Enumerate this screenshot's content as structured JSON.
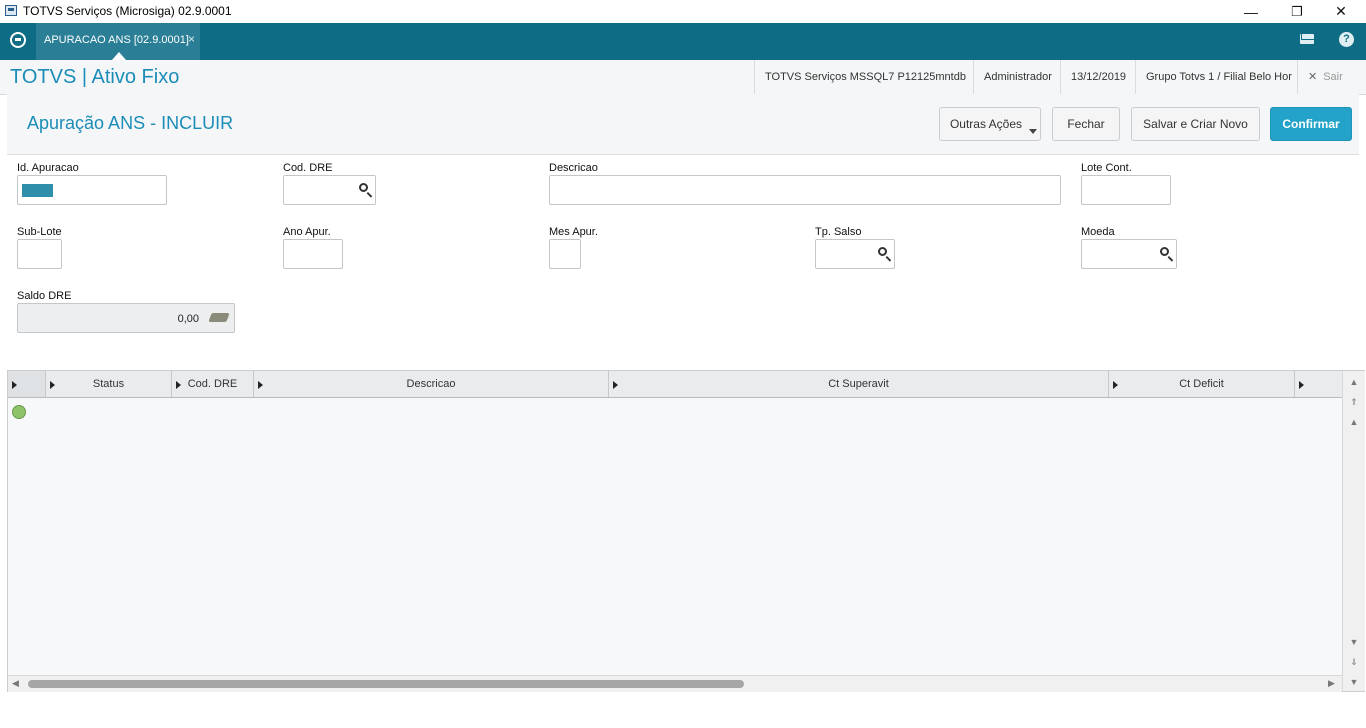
{
  "window": {
    "title": "TOTVS Serviços (Microsiga) 02.9.0001",
    "minimize": "—",
    "restore": "❐",
    "close": "✕"
  },
  "tabbar": {
    "active_tab": "APURACAO ANS [02.9.0001]",
    "tab_close": "×",
    "help": "?"
  },
  "header": {
    "app_title": "TOTVS | Ativo Fixo",
    "environment": "TOTVS Serviços MSSQL7 P12125mntdb",
    "user": "Administrador",
    "date": "13/12/2019",
    "company": "Grupo Totvs 1 / Filial Belo Hor",
    "exit_label": "Sair",
    "exit_icon": "✕"
  },
  "form": {
    "title": "Apuração ANS - INCLUIR",
    "buttons": {
      "more_actions": "Outras Ações",
      "close": "Fechar",
      "save_new": "Salvar e Criar Novo",
      "confirm": "Confirmar"
    },
    "fields": {
      "id_apuracao": {
        "label": "Id. Apuracao",
        "value": ""
      },
      "cod_dre": {
        "label": "Cod. DRE",
        "value": ""
      },
      "descricao": {
        "label": "Descricao",
        "value": ""
      },
      "lote_cont": {
        "label": "Lote Cont.",
        "value": ""
      },
      "sub_lote": {
        "label": "Sub-Lote",
        "value": ""
      },
      "ano_apur": {
        "label": "Ano Apur.",
        "value": ""
      },
      "mes_apur": {
        "label": "Mes Apur.",
        "value": ""
      },
      "tp_salso": {
        "label": "Tp. Salso",
        "value": ""
      },
      "moeda": {
        "label": "Moeda",
        "value": ""
      },
      "saldo_dre": {
        "label": "Saldo DRE",
        "value": "0,00"
      }
    }
  },
  "grid": {
    "columns": [
      "Status",
      "Cod. DRE",
      "Descricao",
      "Ct Superavit",
      "Ct Deficit"
    ],
    "rows": [
      {
        "status": "green"
      }
    ]
  }
}
